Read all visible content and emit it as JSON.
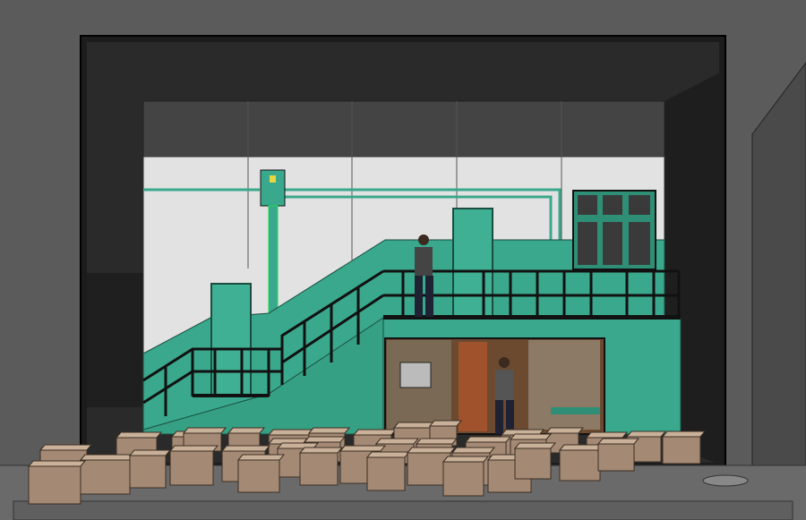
{
  "scene": {
    "subject": "stage-set-model",
    "colors": {
      "outer": "#5b5b5b",
      "proscenium": "#1a1a1a",
      "back_wall": "#e2e2e2",
      "upper_band": "#444444",
      "teal": "#3aa88c",
      "teal_dark": "#2f8f76",
      "rail": "#111111",
      "box_front": "#a48a74",
      "box_top": "#c9b098",
      "floor": "#6a6a6a",
      "room": "#6b4a30"
    }
  }
}
